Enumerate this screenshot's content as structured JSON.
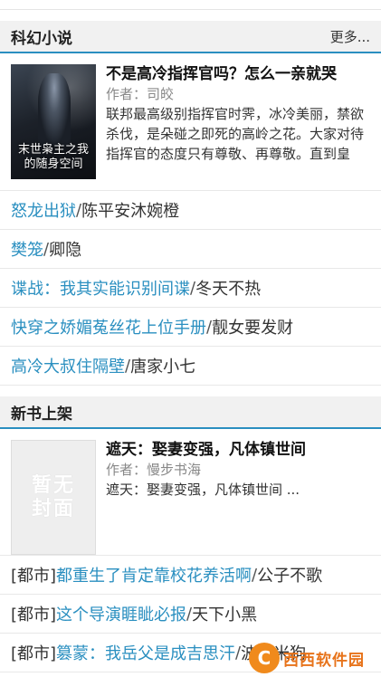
{
  "sections": [
    {
      "title": "科幻小说",
      "more": "更多...",
      "feature": {
        "cover_text": "末世枭主之我的随身空间",
        "title": "不是高冷指挥官吗？怎么一亲就哭",
        "author_label": "作者：",
        "author": "司皎",
        "synopsis": "联邦最高级别指挥官时霁，冰冷美丽，禁欲杀伐，是朵碰之即死的高岭之花。大家对待指挥官的态度只有尊敬、再尊敬。直到皇"
      },
      "links": [
        {
          "title": "怒龙出狱",
          "sep": "/",
          "author": "陈平安沐婉橙"
        },
        {
          "title": "樊笼",
          "sep": "/",
          "author": "卿隐"
        },
        {
          "title": "谍战：我其实能识别间谍",
          "sep": "/",
          "author": "冬天不热"
        },
        {
          "title": "快穿之娇媚菟丝花上位手册",
          "sep": "/",
          "author": "靓女要发财"
        },
        {
          "title": "高冷大叔住隔壁",
          "sep": "/",
          "author": "唐家小七"
        }
      ]
    },
    {
      "title": "新书上架",
      "feature": {
        "cover_text": "暂无封面",
        "title": "遮天：娶妻变强，凡体镇世间",
        "author_label": "作者：",
        "author": "慢步书海",
        "synopsis": "遮天：娶妻变强，凡体镇世间 ..."
      },
      "links": [
        {
          "category": "[都市]",
          "title": "都重生了肯定靠校花养活啊",
          "sep": "/",
          "author": "公子不歌"
        },
        {
          "category": "[都市]",
          "title": "这个导演睚眦必报",
          "sep": "/",
          "author": "天下小黑"
        },
        {
          "category": "[都市]",
          "title": "篡蒙：我岳父是成吉思汗",
          "sep": "/",
          "author": "波西米狗"
        }
      ]
    }
  ],
  "watermark": {
    "logo": "C",
    "text": "西西软件园"
  },
  "colors": {
    "accent": "#2a8fc0",
    "header_bg": "#f1f1f1"
  }
}
